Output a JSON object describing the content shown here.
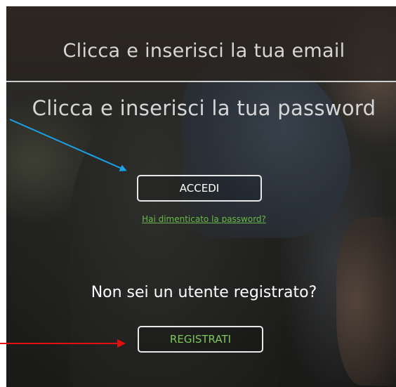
{
  "login_form": {
    "email_placeholder": "Clicca e inserisci la tua email",
    "password_placeholder": "Clicca e inserisci la tua password",
    "login_button": "ACCEDI",
    "forgot_password_link": "Hai dimenticato la password?"
  },
  "registration": {
    "prompt": "Non sei un utente registrato?",
    "register_button": "REGISTRATI"
  },
  "annotations": {
    "blue_arrow_color": "#1aa3e8",
    "red_arrow_color": "#e01010"
  },
  "colors": {
    "link_green": "#68b94a",
    "register_text_green": "#7cc85a",
    "button_border": "#e8e8e8"
  }
}
